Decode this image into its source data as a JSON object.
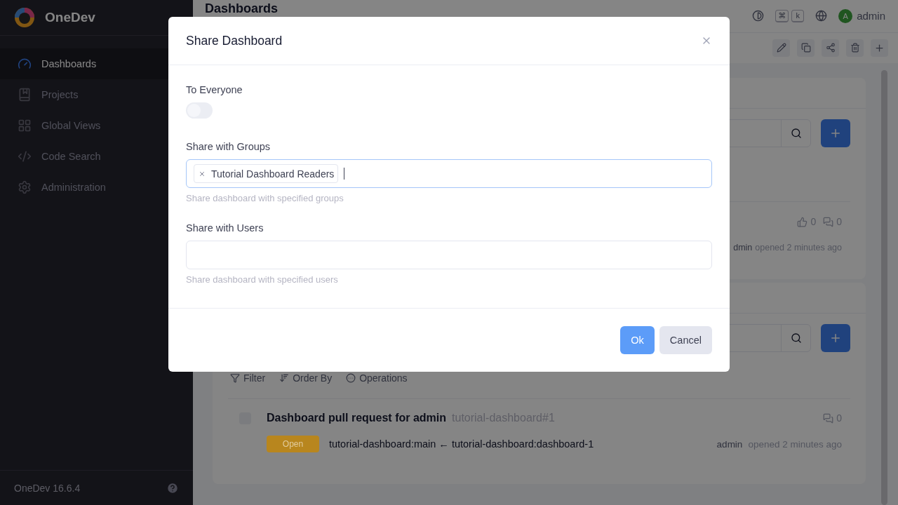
{
  "sidebar": {
    "brand": "OneDev",
    "items": [
      {
        "label": "Dashboards",
        "selected": true
      },
      {
        "label": "Projects",
        "selected": false
      },
      {
        "label": "Global Views",
        "selected": false
      },
      {
        "label": "Code Search",
        "selected": false
      },
      {
        "label": "Administration",
        "selected": false
      }
    ],
    "version": "OneDev 16.6.4"
  },
  "topbar": {
    "title": "Dashboards",
    "shortcut_keys": [
      "⌘",
      "k"
    ],
    "avatar": "A",
    "user": "admin"
  },
  "cards": [
    {
      "kind": "issues",
      "likes": "0",
      "comments": "0",
      "meta_user": "dmin",
      "meta_text": "opened 2 minutes ago"
    },
    {
      "kind": "pulls",
      "filters": [
        "Filter",
        "Order By",
        "Operations"
      ],
      "row": {
        "checked": false,
        "title": "Dashboard pull request for admin",
        "ref": "tutorial-dashboard#1",
        "comments": "0",
        "status": "Open",
        "color": "#b8861e",
        "branches": "tutorial-dashboard:main ← tutorial-dashboard:dashboard-1",
        "meta_user": "admin",
        "meta_text": "opened 2 minutes ago"
      }
    }
  ],
  "dialog": {
    "title": "Share Dashboard",
    "everyone_label": "To Everyone",
    "everyone_on": false,
    "groups_label": "Share with Groups",
    "groups": [
      "Tutorial Dashboard Readers"
    ],
    "groups_focused": true,
    "groups_hint": "Share dashboard with specified groups",
    "users_label": "Share with Users",
    "users_hint": "Share dashboard with specified users",
    "buttons": [
      {
        "label": "Ok",
        "kind": "primary"
      },
      {
        "label": "Cancel",
        "kind": "secondary"
      }
    ]
  }
}
